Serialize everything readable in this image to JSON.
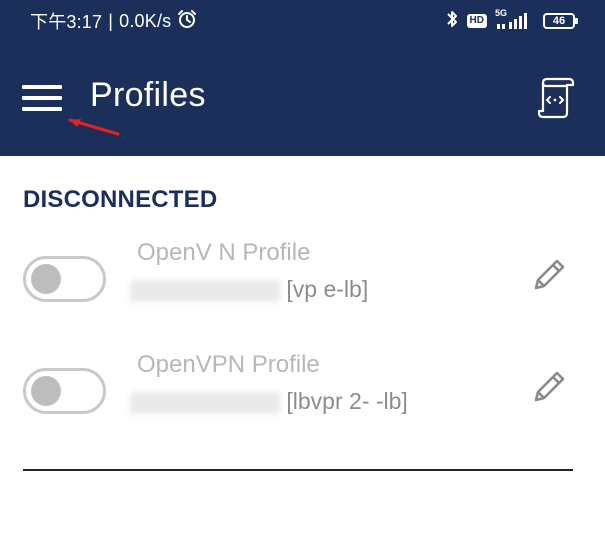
{
  "status_bar": {
    "time_text": "下午3:17",
    "network_speed": "0.0K/s",
    "hd_badge": "HD",
    "network_type": "5G",
    "battery_level": "46",
    "icons": [
      "alarm-icon",
      "bluetooth-icon",
      "hd-icon",
      "signal-icon",
      "battery-icon"
    ]
  },
  "app_bar": {
    "title": "Profiles",
    "menu_icon": "hamburger-menu-icon",
    "import_icon": "import-profile-icon"
  },
  "section": {
    "header": "DISCONNECTED"
  },
  "profiles": [
    {
      "name": "OpenV  N Profile",
      "detail": "[vp          e-lb]",
      "toggle_on": false,
      "edit_icon": "pencil-icon"
    },
    {
      "name": "OpenVPN Profile",
      "detail": "[lbvpr      2-        -lb]",
      "toggle_on": false,
      "edit_icon": "pencil-icon"
    }
  ],
  "colors": {
    "primary": "#1b2f5a",
    "header_text": "#1b2f5a",
    "toggle_border": "#c9c9c9",
    "toggle_knob": "#bdbdbd",
    "annotation": "#e8231c"
  }
}
